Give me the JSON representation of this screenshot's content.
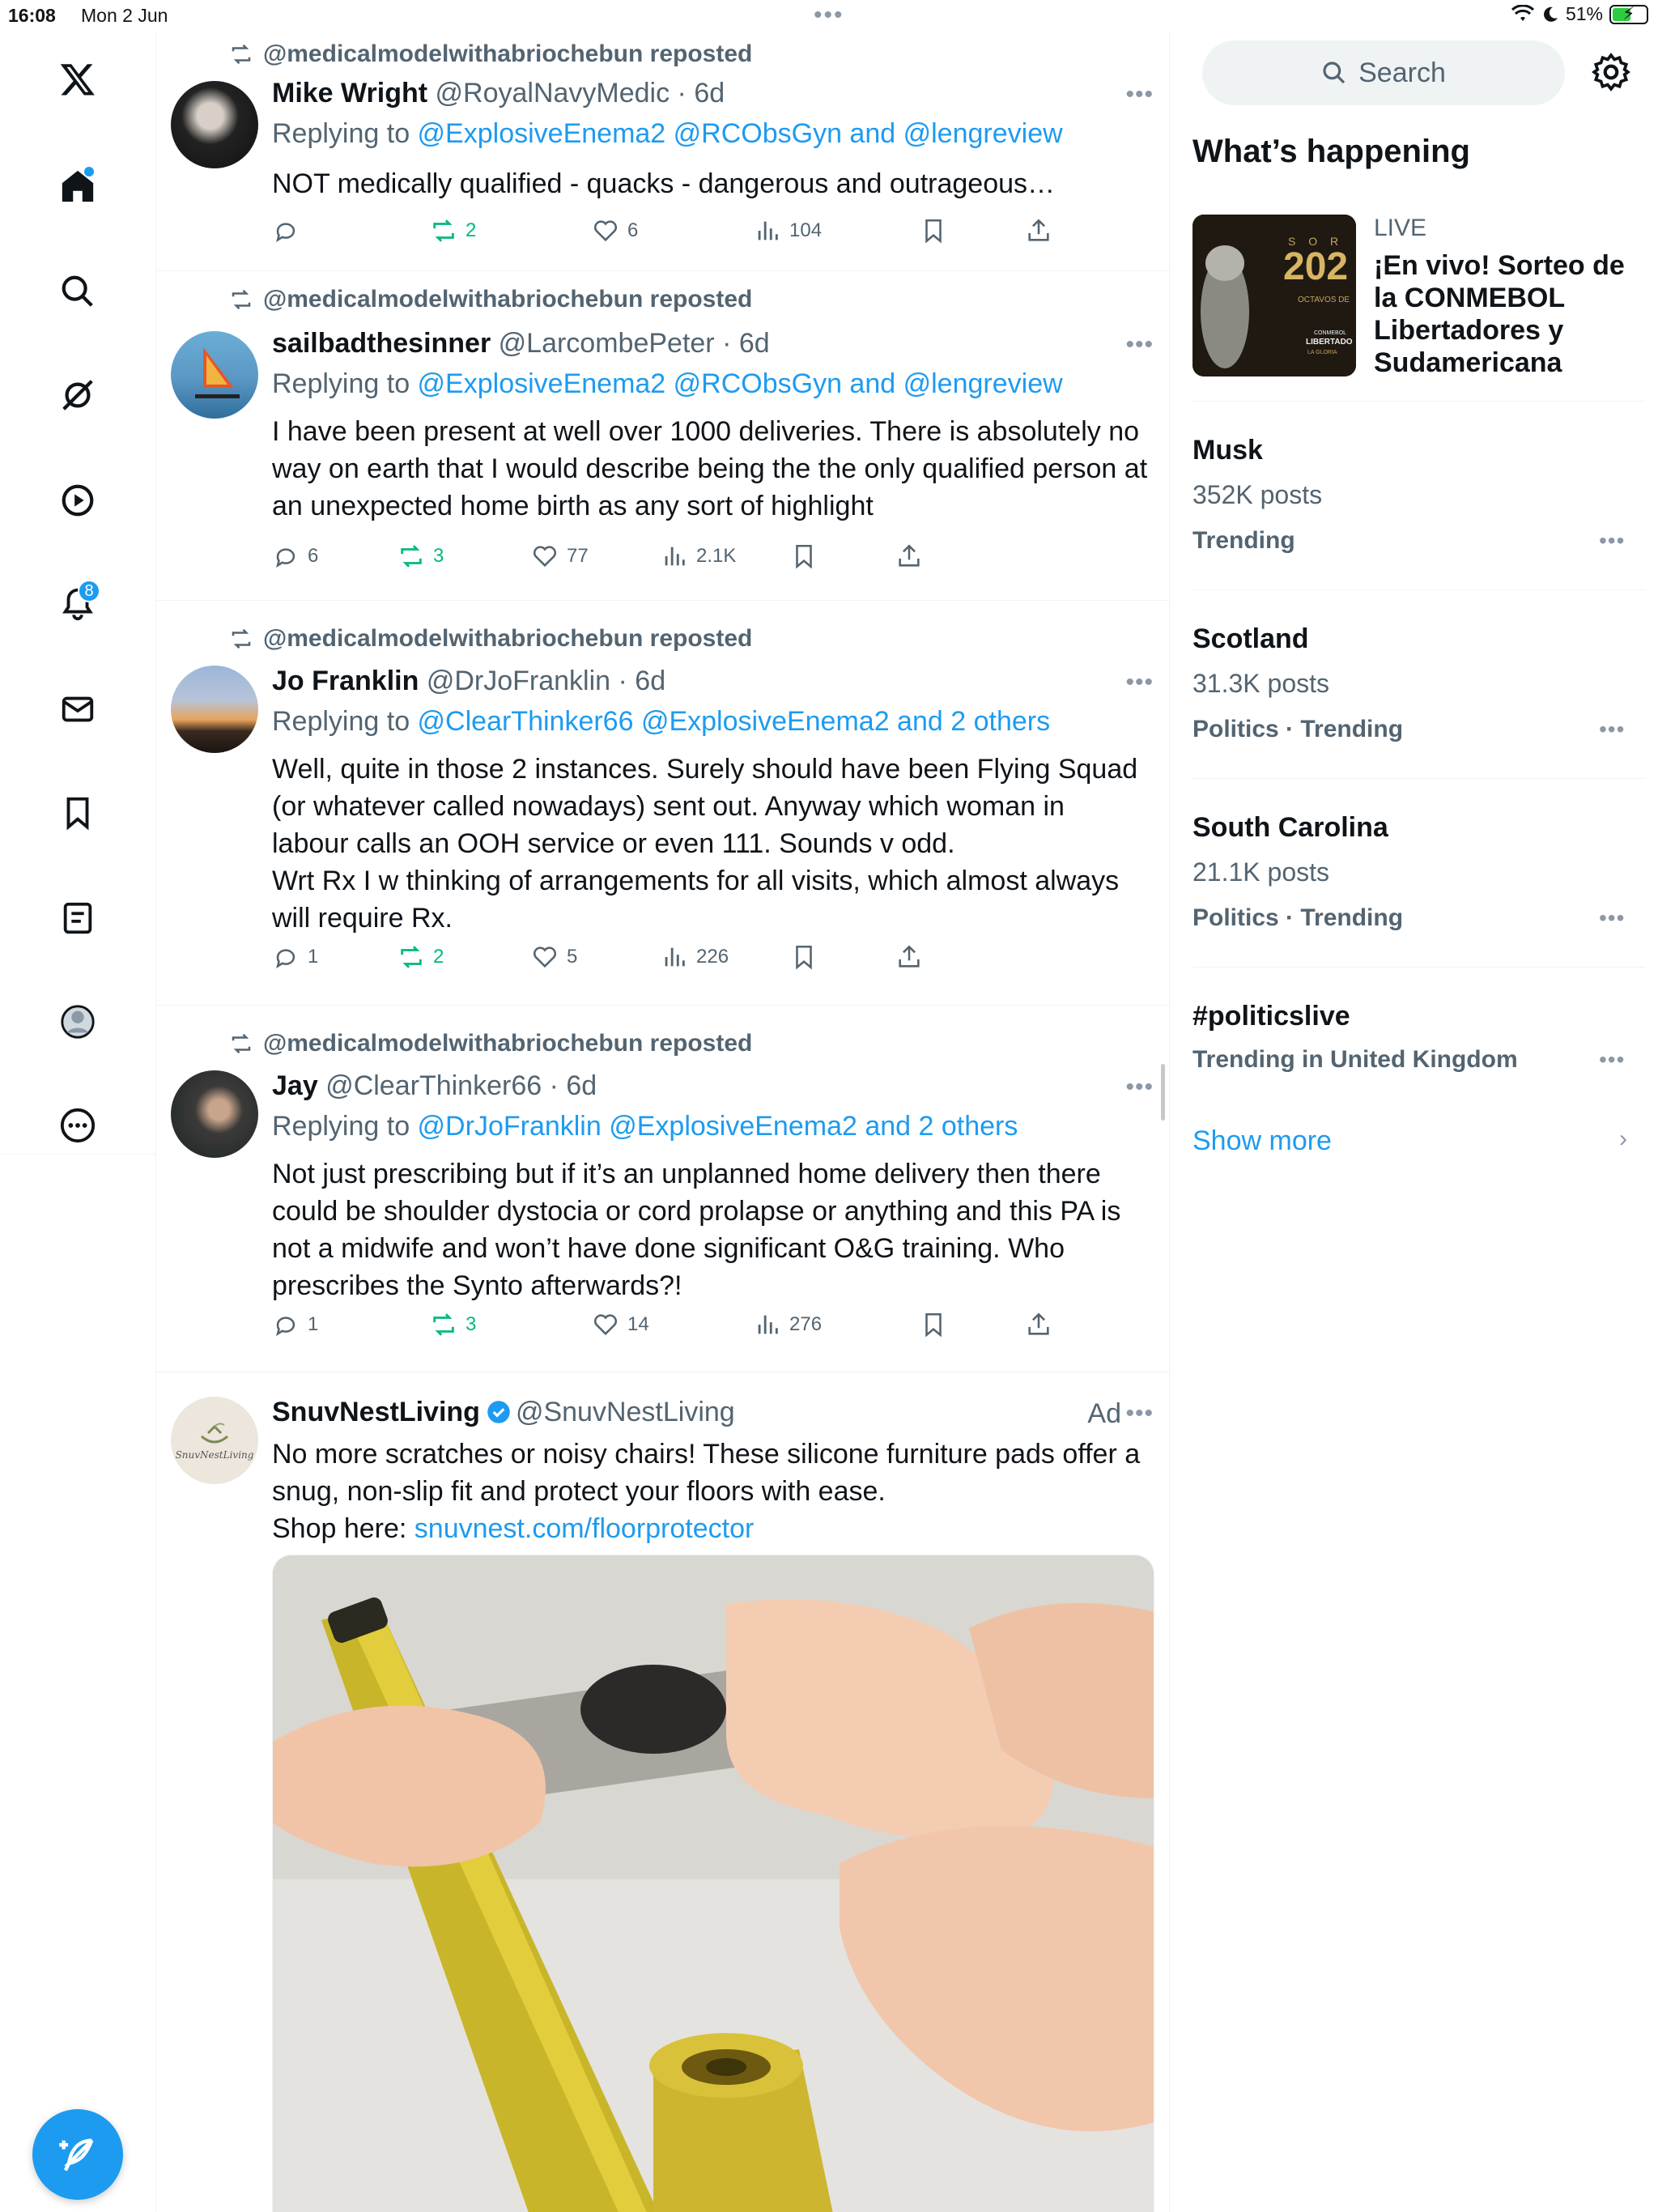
{
  "status_bar": {
    "time": "16:08",
    "date": "Mon 2 Jun",
    "battery": "51%",
    "battery_level": 0.51
  },
  "nav": {
    "notifications_badge": "8",
    "items": [
      "x-logo-icon",
      "home-icon",
      "search-icon",
      "grok-icon",
      "video-icon",
      "notifications-icon",
      "messages-icon",
      "bookmarks-icon",
      "lists-icon",
      "profile-icon",
      "more-icon"
    ]
  },
  "feed": {
    "posts": [
      {
        "repost_by": "@medicalmodelwithabriochebun reposted",
        "name": "Mike Wright",
        "handle": "@RoyalNavyMedic",
        "age": "6d",
        "replying_prefix": "Replying to ",
        "replying_to": "@ExplosiveEnema2 @RCObsGyn and @lengreview",
        "text": "NOT medically qualified - quacks - dangerous and outrageous…",
        "replies": "",
        "reposts": "2",
        "likes": "6",
        "views": "104"
      },
      {
        "repost_by": "@medicalmodelwithabriochebun reposted",
        "name": "sailbadthesinner",
        "handle": "@LarcombePeter",
        "age": "6d",
        "replying_prefix": "Replying to ",
        "replying_to": "@ExplosiveEnema2 @RCObsGyn and @lengreview",
        "text": "I have been present at well over 1000 deliveries. There is absolutely no way on earth that I would describe being the the only qualified person at an unexpected home birth as any sort of highlight",
        "replies": "6",
        "reposts": "3",
        "likes": "77",
        "views": "2.1K"
      },
      {
        "repost_by": "@medicalmodelwithabriochebun reposted",
        "name": "Jo Franklin",
        "handle": "@DrJoFranklin",
        "age": "6d",
        "replying_prefix": "Replying to ",
        "replying_to": "@ClearThinker66 @ExplosiveEnema2 and 2 others",
        "text_lines": [
          "Well, quite in those 2 instances. Surely should have been Flying Squad",
          "(or whatever called nowadays) sent out. Anyway which woman in",
          "labour calls an OOH service or even 111. Sounds v odd.",
          "Wrt Rx I w thinking of arrangements for all visits, which almost always",
          "will require Rx."
        ],
        "replies": "1",
        "reposts": "2",
        "likes": "5",
        "views": "226"
      },
      {
        "repost_by": "@medicalmodelwithabriochebun reposted",
        "name": "Jay",
        "handle": "@ClearThinker66",
        "age": "6d",
        "replying_prefix": "Replying to ",
        "replying_to": "@DrJoFranklin @ExplosiveEnema2 and 2 others",
        "text": "Not just prescribing but if it’s an unplanned home delivery then there could be shoulder dystocia or cord prolapse or anything and this PA is not a midwife and won’t have done significant O&G training. Who prescribes the Synto afterwards?!",
        "replies": "1",
        "reposts": "3",
        "likes": "14",
        "views": "276"
      }
    ],
    "ad": {
      "name": "SnuvNestLiving",
      "handle": "@SnuvNestLiving",
      "label": "Ad",
      "text_lines": [
        "No more scratches or noisy chairs! These silicone furniture pads offer a",
        "snug, non-slip fit and protect your floors with ease."
      ],
      "shop_prefix": "Shop here: ",
      "shop_link": "snuvnest.com/floorprotector",
      "logo_text": "SnuvNestLiving"
    }
  },
  "sidebar": {
    "search_placeholder": "Search",
    "whats_happening": "What’s happening",
    "live": {
      "label": "LIVE",
      "title": "¡En vivo! Sorteo de la CONMEBOL Libertadores y Sudamericana",
      "thumb_texts": [
        "S O R",
        "202",
        "OCTAVOS DE",
        "CONMEBOL",
        "LIBERTADO",
        "LA GLORIA"
      ]
    },
    "trends": [
      {
        "name": "Musk",
        "count": "352K posts",
        "meta": "Trending"
      },
      {
        "name": "Scotland",
        "count": "31.3K posts",
        "meta": "Politics · Trending"
      },
      {
        "name": "South Carolina",
        "count": "21.1K posts",
        "meta": "Politics · Trending"
      },
      {
        "name": "#politicslive",
        "count": "",
        "meta": "Trending in United Kingdom"
      }
    ],
    "show_more": "Show more"
  },
  "colors": {
    "accent": "#1d9bf0",
    "repost_green": "#00ba7c",
    "muted_text": "#536471",
    "divider": "#eff3f4"
  }
}
